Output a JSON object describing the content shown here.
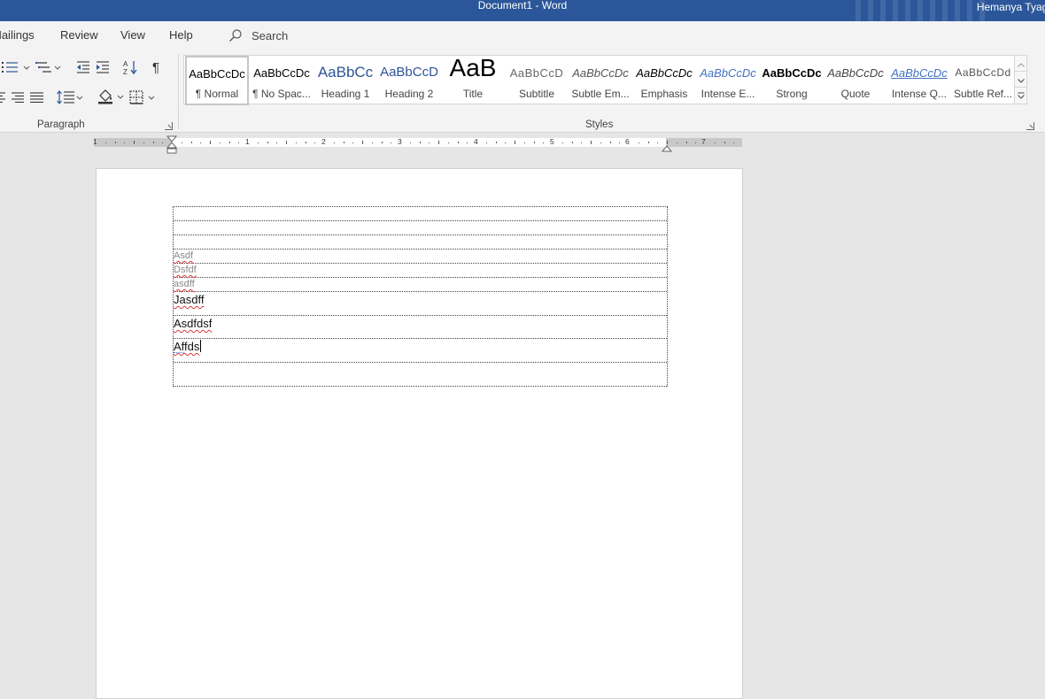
{
  "titlebar": {
    "title": "Document1  -  Word",
    "user": "Hemanya Tyagi"
  },
  "menu": {
    "tabs": [
      "Mailings",
      "Review",
      "View",
      "Help"
    ],
    "search_label": "Search"
  },
  "ribbon": {
    "paragraph_label": "Paragraph",
    "styles_label": "Styles",
    "styles": [
      {
        "preview": "AaBbCcDc",
        "name": "¶ Normal"
      },
      {
        "preview": "AaBbCcDc",
        "name": "¶ No Spac..."
      },
      {
        "preview": "AaBbCc",
        "name": "Heading 1"
      },
      {
        "preview": "AaBbCcD",
        "name": "Heading 2"
      },
      {
        "preview": "AaB",
        "name": "Title"
      },
      {
        "preview": "AaBbCcD",
        "name": "Subtitle"
      },
      {
        "preview": "AaBbCcDc",
        "name": "Subtle Em..."
      },
      {
        "preview": "AaBbCcDc",
        "name": "Emphasis"
      },
      {
        "preview": "AaBbCcDc",
        "name": "Intense E..."
      },
      {
        "preview": "AaBbCcDc",
        "name": "Strong"
      },
      {
        "preview": "AaBbCcDc",
        "name": "Quote"
      },
      {
        "preview": "AaBbCcDc",
        "name": "Intense Q..."
      },
      {
        "preview": "AaBbCcDd",
        "name": "Subtle Ref..."
      }
    ],
    "selected_style": "¶ Normal",
    "colors": {
      "accent": "#2b579a",
      "heading_blue": "#2f5496",
      "intense_blue": "#4472c4"
    }
  },
  "ruler": {
    "labels": [
      "1",
      "1",
      "2",
      "3",
      "4",
      "5",
      "6",
      "7"
    ]
  },
  "document": {
    "rows": [
      {
        "text": ""
      },
      {
        "text": ""
      },
      {
        "text": ""
      },
      {
        "text": "Asdf"
      },
      {
        "text": "Dsfdf"
      },
      {
        "text": "asdff"
      },
      {
        "text": "Jasdff"
      },
      {
        "text": "Asdfdsf"
      },
      {
        "text": "Affds"
      },
      {
        "text": ""
      }
    ]
  }
}
